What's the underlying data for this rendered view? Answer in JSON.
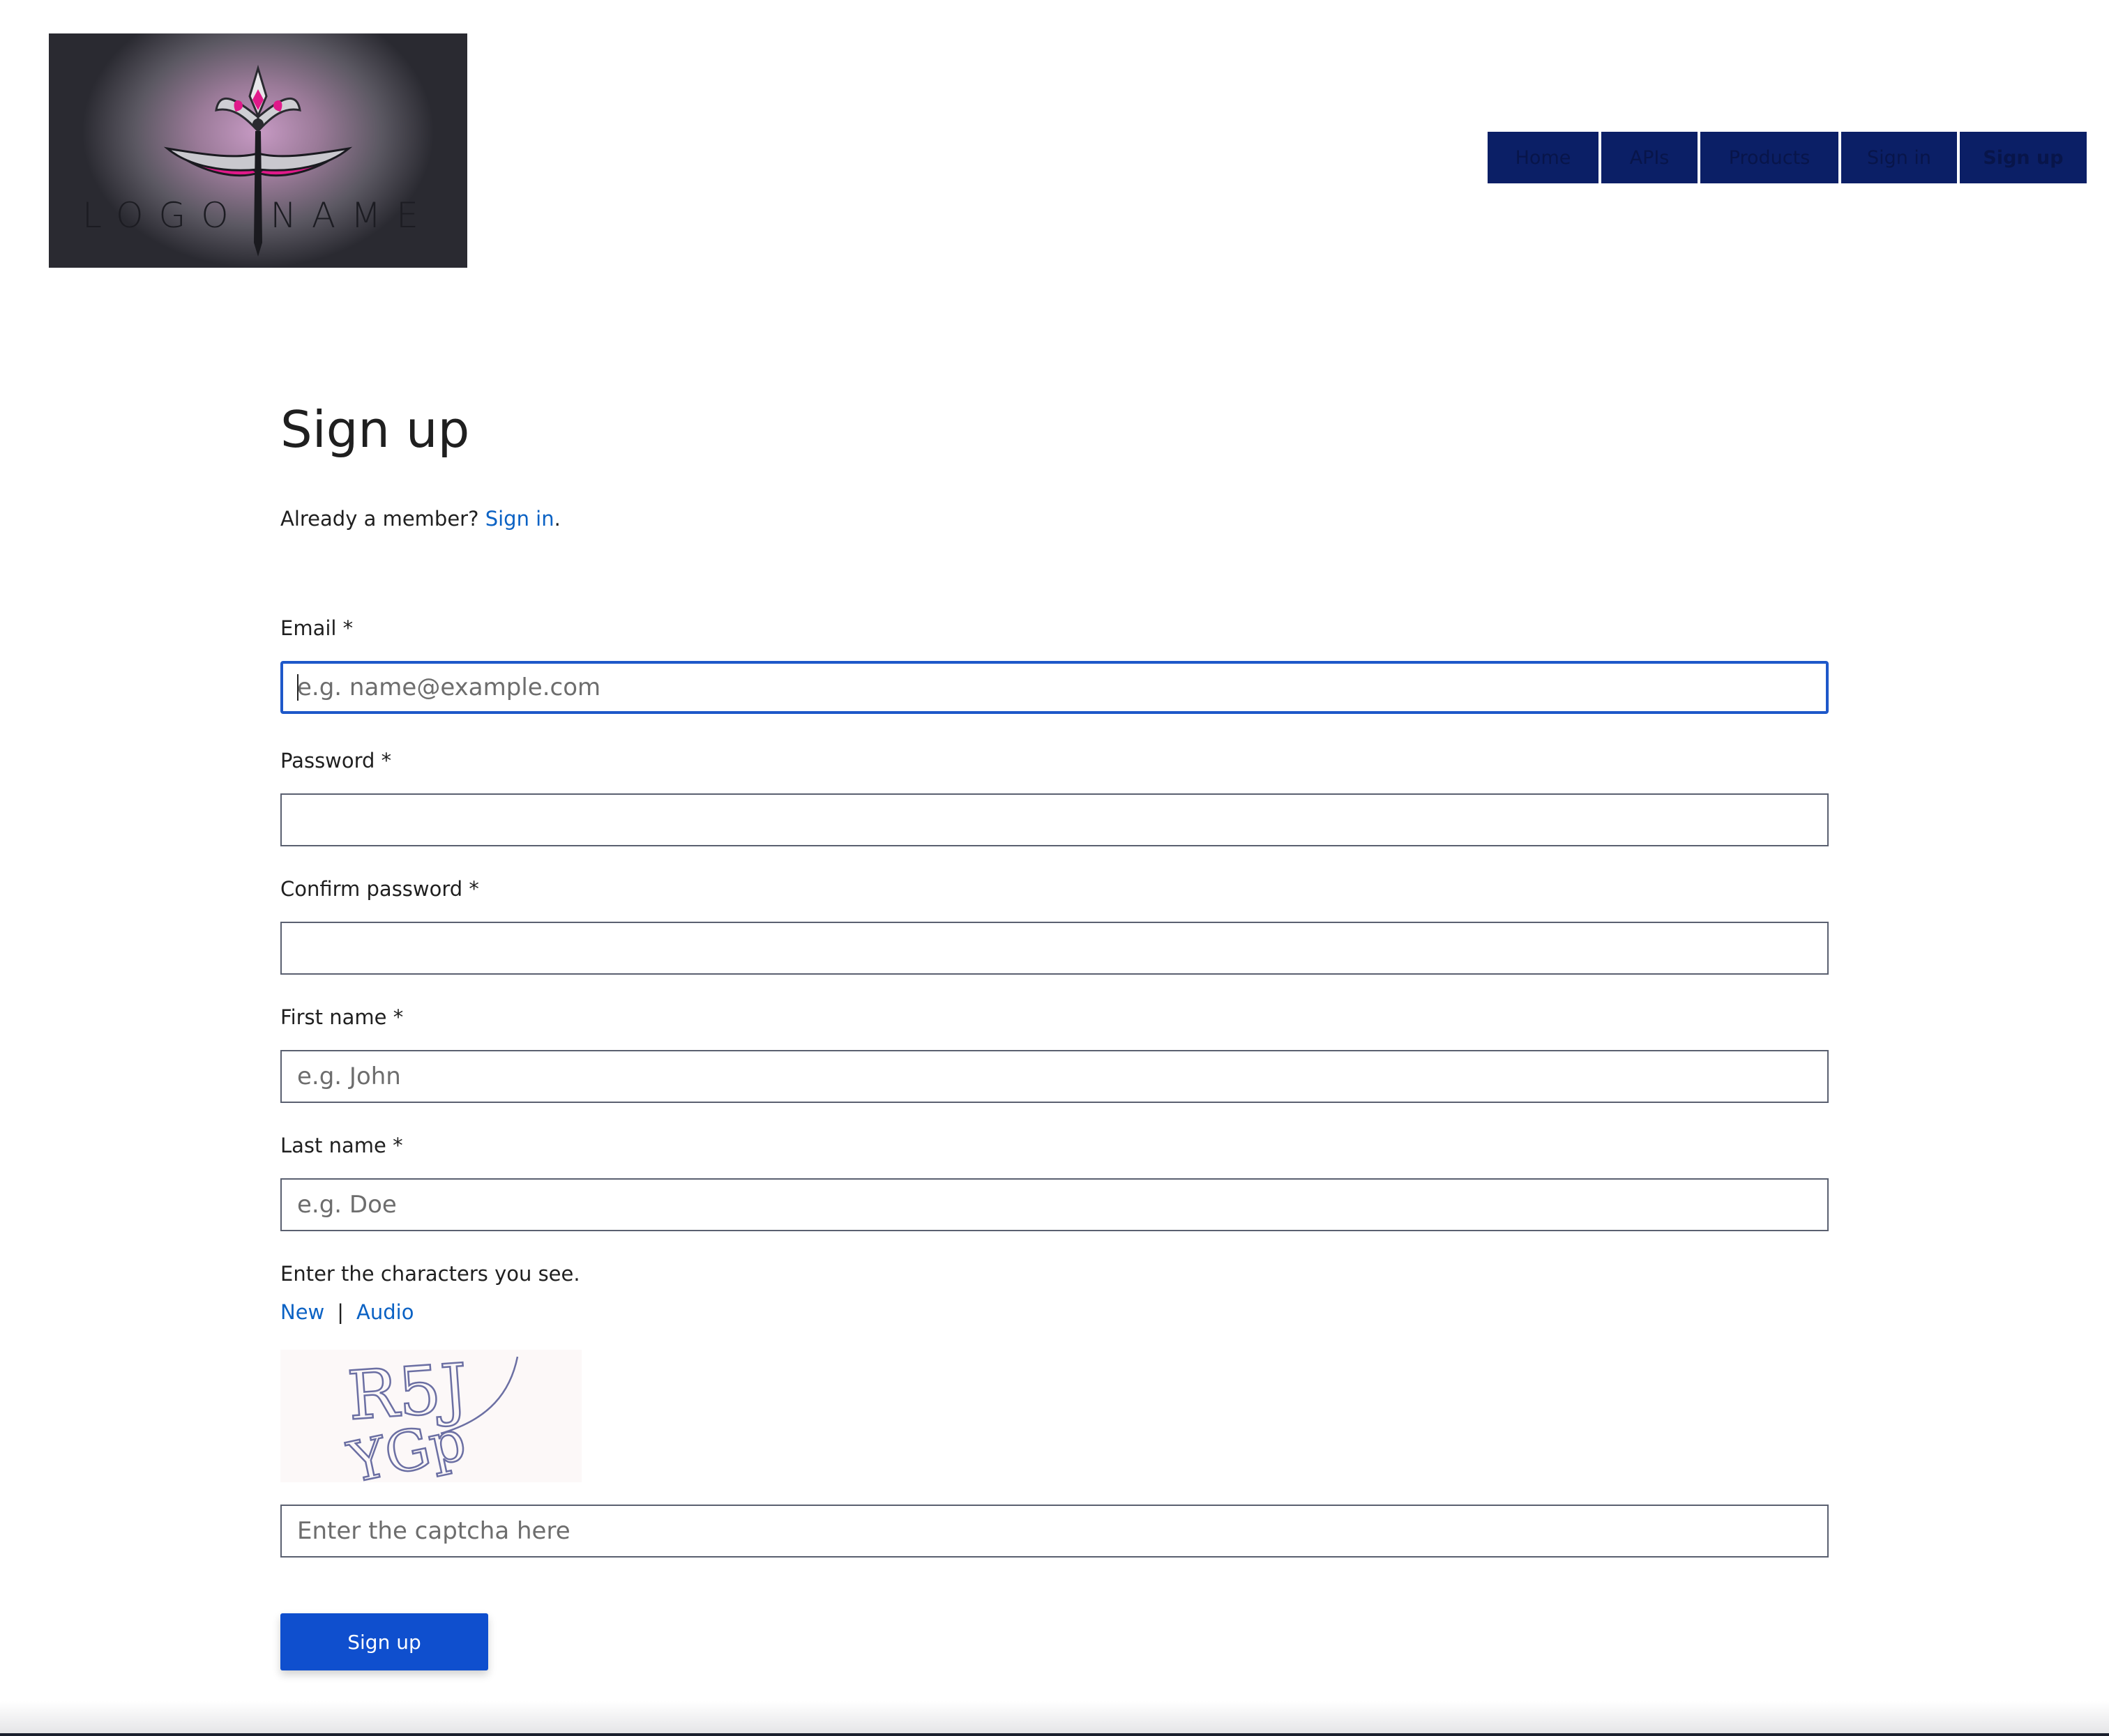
{
  "logo": {
    "text": "LOGO NAME"
  },
  "nav": [
    {
      "label": "Home"
    },
    {
      "label": "APIs"
    },
    {
      "label": "Products"
    },
    {
      "label": "Sign in"
    },
    {
      "label": "Sign up",
      "active": true
    }
  ],
  "page": {
    "title": "Sign up",
    "member_prompt": "Already a member?",
    "member_link": "Sign in",
    "member_suffix": "."
  },
  "form": {
    "email": {
      "label": "Email *",
      "placeholder": "e.g. name@example.com",
      "value": ""
    },
    "password": {
      "label": "Password *",
      "value": ""
    },
    "confirm_password": {
      "label": "Confirm password *",
      "value": ""
    },
    "first_name": {
      "label": "First name *",
      "placeholder": "e.g. John",
      "value": ""
    },
    "last_name": {
      "label": "Last name *",
      "placeholder": "e.g. Doe",
      "value": ""
    },
    "captcha": {
      "instruction": "Enter the characters you see.",
      "new_link": "New",
      "separator": "|",
      "audio_link": "Audio",
      "placeholder": "Enter the captcha here",
      "image_text": "R5J YGp"
    },
    "submit_label": "Sign up"
  },
  "colors": {
    "nav_bg": "#0b1f66",
    "link": "#0b62c4",
    "primary_button": "#0f4fce",
    "focus_border": "#1e58c9"
  }
}
